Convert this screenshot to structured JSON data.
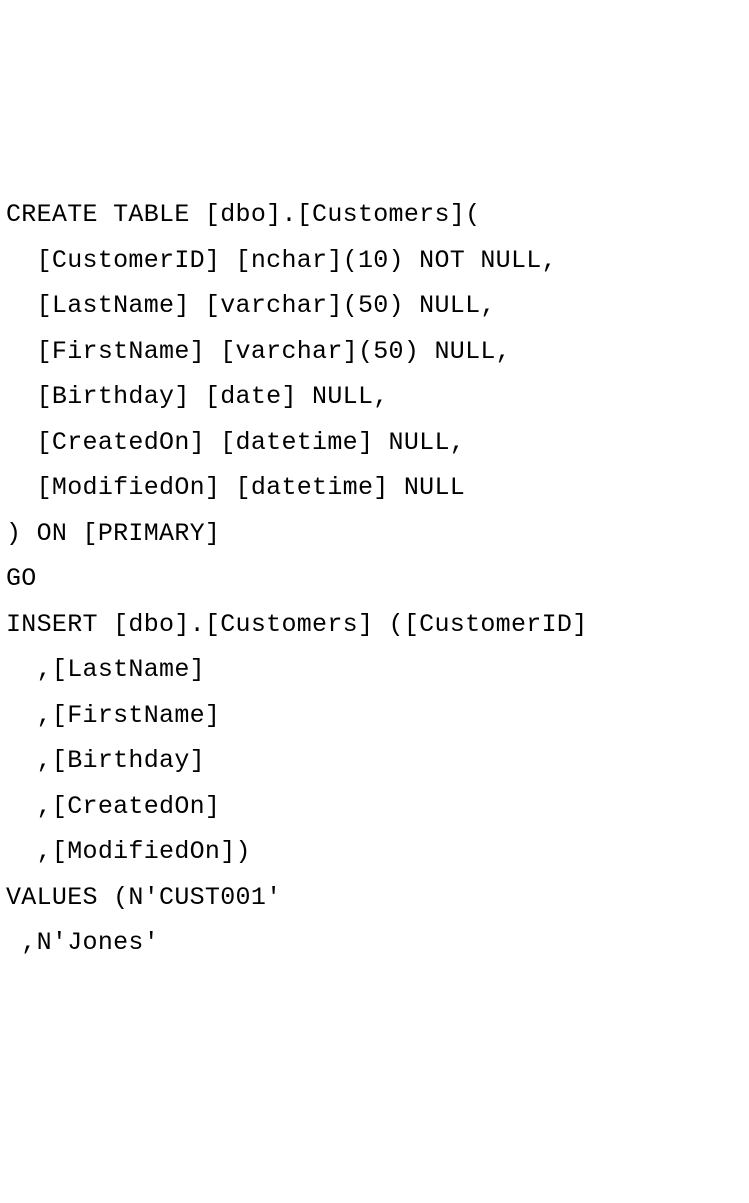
{
  "code": {
    "lines": [
      "CREATE TABLE [dbo].[Customers](",
      "  [CustomerID] [nchar](10) NOT NULL,",
      "  [LastName] [varchar](50) NULL,",
      "  [FirstName] [varchar](50) NULL,",
      "  [Birthday] [date] NULL,",
      "  [CreatedOn] [datetime] NULL,",
      "  [ModifiedOn] [datetime] NULL",
      ") ON [PRIMARY]",
      "GO",
      "INSERT [dbo].[Customers] ([CustomerID]",
      "  ,[LastName]",
      "  ,[FirstName]",
      "  ,[Birthday]",
      "  ,[CreatedOn]",
      "  ,[ModifiedOn])",
      "VALUES (N'CUST001'",
      " ,N'Jones'"
    ]
  }
}
